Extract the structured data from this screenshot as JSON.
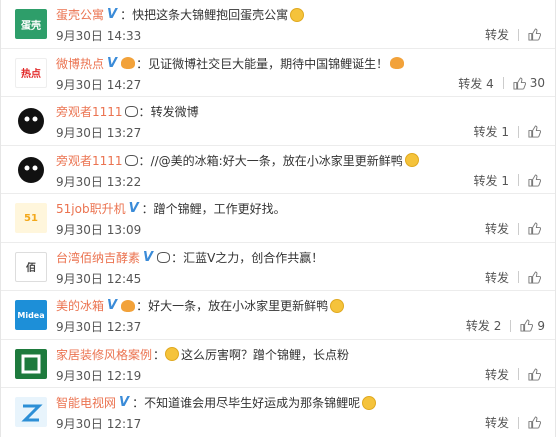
{
  "items": [
    {
      "name": "蛋壳公寓",
      "avatar_color": "#2e9e6a",
      "avatar_text": "蛋壳",
      "badge": "V",
      "emoji": "",
      "content": "快把这条大锦鲤抱回蛋壳公寓",
      "trail": "face",
      "time": "9月30日 14:33",
      "forward": "转发",
      "like": ""
    },
    {
      "name": "微博热点",
      "avatar_color": "#e22b2b",
      "avatar_text": "热点",
      "badge": "V",
      "emoji": "fire",
      "content": "见证微博社交巨大能量，期待中国锦鲤诞生！",
      "trail": "fire",
      "time": "9月30日 14:27",
      "forward": "转发 4",
      "like": "30"
    },
    {
      "name": "旁观者1111",
      "avatar_color": "#111111",
      "avatar_text": "",
      "badge": "",
      "emoji": "panda",
      "content": "转发微博",
      "trail": "",
      "time": "9月30日 13:27",
      "forward": "转发 1",
      "like": ""
    },
    {
      "name": "旁观者1111",
      "avatar_color": "#111111",
      "avatar_text": "",
      "badge": "",
      "emoji": "panda",
      "content": "//@美的冰箱:好大一条，放在小冰家里更新鲜鸭",
      "trail": "face",
      "time": "9月30日 13:22",
      "forward": "转发 1",
      "like": ""
    },
    {
      "name": "51job职升机",
      "avatar_color": "#f3a81b",
      "avatar_text": "51",
      "badge": "V",
      "emoji": "",
      "content": "蹭个锦鲤，工作更好找。",
      "trail": "",
      "time": "9月30日 13:09",
      "forward": "转发",
      "like": ""
    },
    {
      "name": "台湾佰纳吉酵素",
      "avatar_color": "#555555",
      "avatar_text": "佰",
      "badge": "V",
      "emoji": "panda",
      "content": "汇蓝V之力，创合作共赢！",
      "trail": "",
      "time": "9月30日 12:45",
      "forward": "转发",
      "like": ""
    },
    {
      "name": "美的冰箱",
      "avatar_color": "#1d8fd8",
      "avatar_text": "Midea",
      "badge": "V",
      "emoji": "fire",
      "content": "好大一条，放在小冰家里更新鲜鸭",
      "trail": "face",
      "time": "9月30日 12:37",
      "forward": "转发 2",
      "like": "9"
    },
    {
      "name": "家居装修风格案例",
      "avatar_color": "#1e7a3d",
      "avatar_text": "",
      "badge": "",
      "emoji": "",
      "content": "这么厉害啊？蹭个锦鲤，长点粉",
      "trail": "face-lead",
      "time": "9月30日 12:19",
      "forward": "转发",
      "like": ""
    },
    {
      "name": "智能电视网",
      "avatar_color": "#2d8fd6",
      "avatar_text": "",
      "badge": "V",
      "emoji": "",
      "content": "不知道谁会用尽毕生好运成为那条锦鲤呢",
      "trail": "face",
      "time": "9月30日 12:17",
      "forward": "转发",
      "like": ""
    }
  ]
}
